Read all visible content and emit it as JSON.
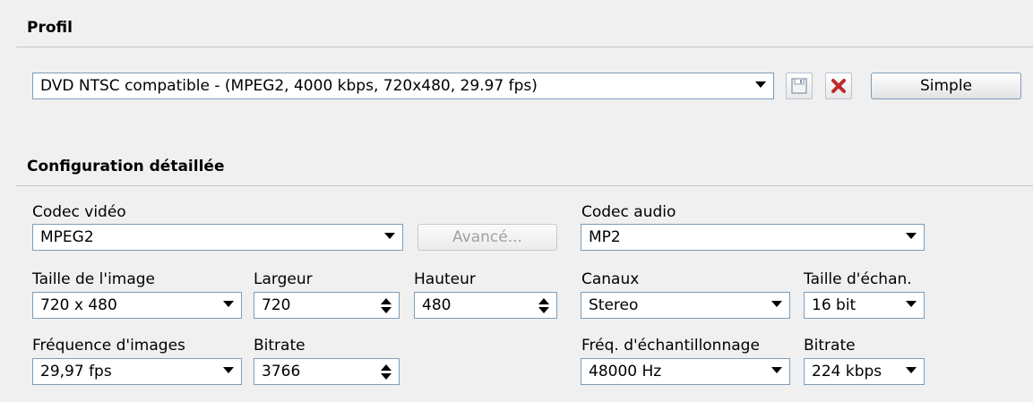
{
  "profile": {
    "section_title": "Profil",
    "selected": "DVD NTSC compatible - (MPEG2, 4000 kbps, 720x480, 29.97 fps)",
    "simple_button": "Simple"
  },
  "detail": {
    "section_title": "Configuration détaillée",
    "video_codec": {
      "label": "Codec vidéo",
      "value": "MPEG2"
    },
    "advanced_button": "Avancé...",
    "audio_codec": {
      "label": "Codec audio",
      "value": "MP2"
    },
    "image_size": {
      "label": "Taille de l'image",
      "value": "720 x 480"
    },
    "width": {
      "label": "Largeur",
      "value": "720"
    },
    "height": {
      "label": "Hauteur",
      "value": "480"
    },
    "channels": {
      "label": "Canaux",
      "value": "Stereo"
    },
    "sample_size": {
      "label": "Taille d'échan.",
      "value": "16 bit"
    },
    "frame_rate": {
      "label": "Fréquence d'images",
      "value": "29,97 fps"
    },
    "video_bitrate": {
      "label": "Bitrate",
      "value": "3766"
    },
    "sample_rate": {
      "label": "Fréq. d'échantillonnage",
      "value": "48000 Hz"
    },
    "audio_bitrate": {
      "label": "Bitrate",
      "value": "224 kbps"
    }
  },
  "colors": {
    "delete_red": "#c0282d",
    "border": "#7f9db9",
    "background": "#f0f0f0"
  }
}
